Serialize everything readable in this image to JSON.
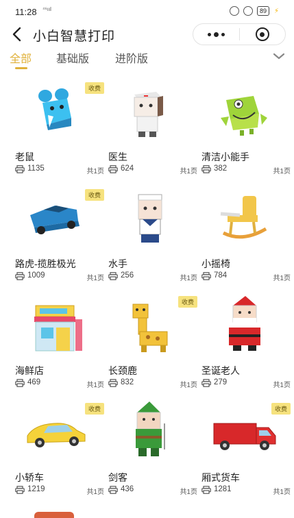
{
  "status": {
    "time": "11:28",
    "network": "⁴⁶ııl",
    "battery": "89"
  },
  "nav": {
    "title": "小白智慧打印"
  },
  "tabs": [
    {
      "label": "全部",
      "active": true
    },
    {
      "label": "基础版",
      "active": false
    },
    {
      "label": "进阶版",
      "active": false
    }
  ],
  "accent_color": "#e0b13a",
  "badge_color": "#f6e27e",
  "items": [
    {
      "title": "老鼠",
      "count": "1135",
      "pages": "共1页",
      "badge": "收费",
      "icon": "blue-mouse-papercraft"
    },
    {
      "title": "医生",
      "count": "624",
      "pages": "共1页",
      "badge": "",
      "icon": "doctor-papercraft"
    },
    {
      "title": "清洁小能手",
      "count": "382",
      "pages": "共1页",
      "badge": "",
      "icon": "green-cleaner-papercraft"
    },
    {
      "title": "路虎-揽胜极光",
      "count": "1009",
      "pages": "共1页",
      "badge": "收费",
      "icon": "blue-suv-papercraft"
    },
    {
      "title": "水手",
      "count": "256",
      "pages": "共1页",
      "badge": "",
      "icon": "sailor-papercraft"
    },
    {
      "title": "小摇椅",
      "count": "784",
      "pages": "共1页",
      "badge": "",
      "icon": "rocking-chair-papercraft"
    },
    {
      "title": "海鲜店",
      "count": "469",
      "pages": "共1页",
      "badge": "",
      "icon": "seafood-shop-papercraft"
    },
    {
      "title": "长颈鹿",
      "count": "832",
      "pages": "共1页",
      "badge": "收费",
      "icon": "giraffe-papercraft"
    },
    {
      "title": "圣诞老人",
      "count": "279",
      "pages": "共1页",
      "badge": "",
      "icon": "santa-papercraft"
    },
    {
      "title": "小轿车",
      "count": "1219",
      "pages": "共1页",
      "badge": "收费",
      "icon": "yellow-car-papercraft"
    },
    {
      "title": "剑客",
      "count": "436",
      "pages": "共1页",
      "badge": "",
      "icon": "swordsman-papercraft"
    },
    {
      "title": "厢式货车",
      "count": "1281",
      "pages": "共1页",
      "badge": "收费",
      "icon": "red-truck-papercraft"
    }
  ]
}
